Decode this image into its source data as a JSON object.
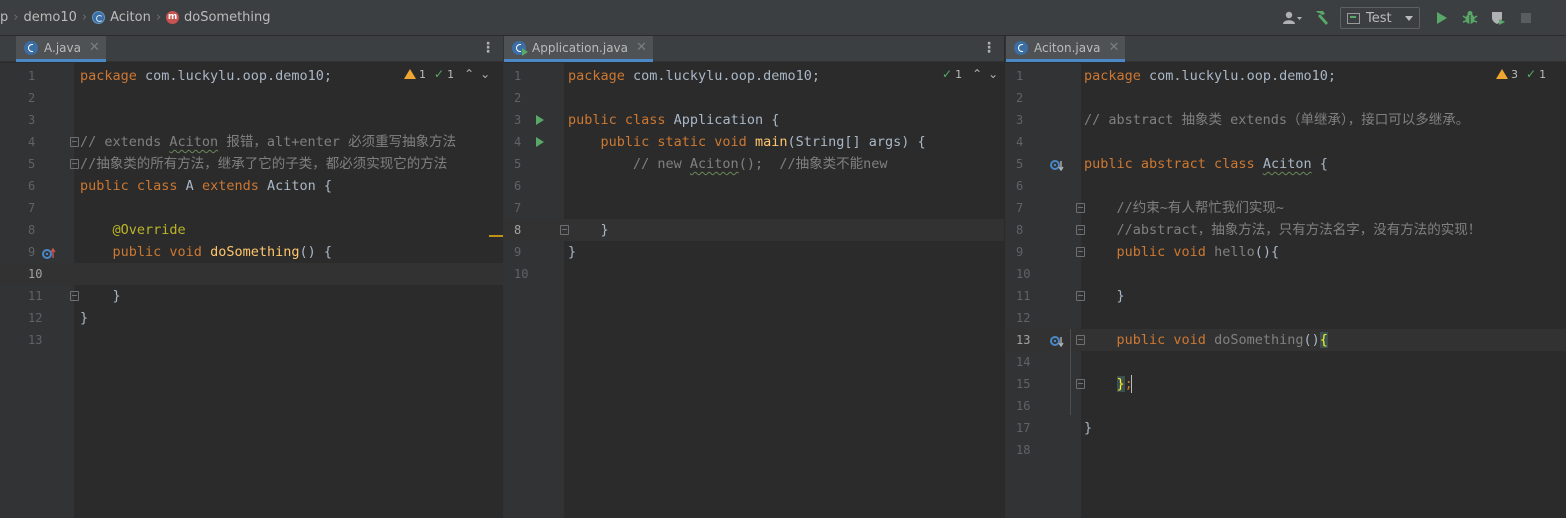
{
  "breadcrumb": {
    "items": [
      {
        "label": "p",
        "icon": ""
      },
      {
        "label": "demo10",
        "icon": ""
      },
      {
        "label": "Aciton",
        "icon": "class-icon"
      },
      {
        "label": "doSomething",
        "icon": "method-icon"
      }
    ]
  },
  "toolbar": {
    "run_config": "Test",
    "icons": [
      "user-icon",
      "hammer-icon",
      "run-icon",
      "debug-icon",
      "coverage-icon",
      "stop-icon"
    ]
  },
  "panes": {
    "a": {
      "tab": "A.java",
      "inspections": {
        "warnings": "1",
        "checks": "1"
      },
      "lines": [
        {
          "n": "1",
          "t": [
            {
              "c": "kw",
              "s": "package "
            },
            {
              "c": "",
              "s": "com.luckylu.oop.demo10;"
            }
          ]
        },
        {
          "n": "2",
          "t": []
        },
        {
          "n": "3",
          "t": []
        },
        {
          "n": "4",
          "t": [
            {
              "c": "cm",
              "s": "// extends "
            },
            {
              "c": "cm wavy",
              "s": "Aciton"
            },
            {
              "c": "cm",
              "s": " 报错，alt+enter 必须重写抽象方法"
            }
          ]
        },
        {
          "n": "5",
          "t": [
            {
              "c": "cm",
              "s": "//抽象类的所有方法，继承了它的子类，都必须实现它的方法"
            }
          ]
        },
        {
          "n": "6",
          "t": [
            {
              "c": "kw",
              "s": "public class "
            },
            {
              "c": "",
              "s": "A "
            },
            {
              "c": "kw",
              "s": "extends "
            },
            {
              "c": "",
              "s": "Aciton {"
            }
          ]
        },
        {
          "n": "7",
          "t": []
        },
        {
          "n": "8",
          "t": [
            {
              "c": "",
              "s": "    "
            },
            {
              "c": "an",
              "s": "@Override"
            }
          ]
        },
        {
          "n": "9",
          "t": [
            {
              "c": "",
              "s": "    "
            },
            {
              "c": "kw",
              "s": "public void "
            },
            {
              "c": "fn",
              "s": "doSomething"
            },
            {
              "c": "",
              "s": "() {"
            }
          ]
        },
        {
          "n": "10",
          "t": []
        },
        {
          "n": "11",
          "t": [
            {
              "c": "",
              "s": "    }"
            }
          ]
        },
        {
          "n": "12",
          "t": [
            {
              "c": "",
              "s": "}"
            }
          ]
        },
        {
          "n": "13",
          "t": []
        }
      ]
    },
    "b": {
      "tab": "Application.java",
      "inspections": {
        "checks": "1"
      },
      "lines": [
        {
          "n": "1",
          "t": [
            {
              "c": "kw",
              "s": "package "
            },
            {
              "c": "",
              "s": "com.luckylu.oop.demo10;"
            }
          ]
        },
        {
          "n": "2",
          "t": []
        },
        {
          "n": "3",
          "t": [
            {
              "c": "kw",
              "s": "public class "
            },
            {
              "c": "",
              "s": "Application {"
            }
          ]
        },
        {
          "n": "4",
          "t": [
            {
              "c": "",
              "s": "    "
            },
            {
              "c": "kw",
              "s": "public static void "
            },
            {
              "c": "fn",
              "s": "main"
            },
            {
              "c": "",
              "s": "(String[] args) {"
            }
          ]
        },
        {
          "n": "5",
          "t": [
            {
              "c": "cm",
              "s": "        // new "
            },
            {
              "c": "cm wavy",
              "s": "Aciton"
            },
            {
              "c": "cm",
              "s": "();  //抽象类不能new"
            }
          ]
        },
        {
          "n": "6",
          "t": []
        },
        {
          "n": "7",
          "t": []
        },
        {
          "n": "8",
          "t": [
            {
              "c": "",
              "s": "    }"
            }
          ]
        },
        {
          "n": "9",
          "t": [
            {
              "c": "",
              "s": "}"
            }
          ]
        },
        {
          "n": "10",
          "t": []
        }
      ]
    },
    "c": {
      "tab": "Aciton.java",
      "inspections": {
        "warnings": "3",
        "checks": "1"
      },
      "lines": [
        {
          "n": "1",
          "t": [
            {
              "c": "kw",
              "s": "package "
            },
            {
              "c": "",
              "s": "com.luckylu.oop.demo10;"
            }
          ]
        },
        {
          "n": "2",
          "t": []
        },
        {
          "n": "3",
          "t": [
            {
              "c": "cm",
              "s": "// abstract 抽象类 extends（单继承），接口可以多继承。"
            }
          ]
        },
        {
          "n": "4",
          "t": []
        },
        {
          "n": "5",
          "t": [
            {
              "c": "kw",
              "s": "public abstract class "
            },
            {
              "c": "wavy",
              "s": "Aciton"
            },
            {
              "c": "",
              "s": " {"
            }
          ]
        },
        {
          "n": "6",
          "t": []
        },
        {
          "n": "7",
          "t": [
            {
              "c": "cm",
              "s": "    //约束~有人帮忙我们实现~"
            }
          ]
        },
        {
          "n": "8",
          "t": [
            {
              "c": "cm",
              "s": "    //abstract，抽象方法，只有方法名字，没有方法的实现！"
            }
          ]
        },
        {
          "n": "9",
          "t": [
            {
              "c": "",
              "s": "    "
            },
            {
              "c": "kw",
              "s": "public void "
            },
            {
              "c": "unused",
              "s": "hello"
            },
            {
              "c": "",
              "s": "(){"
            }
          ]
        },
        {
          "n": "10",
          "t": []
        },
        {
          "n": "11",
          "t": [
            {
              "c": "",
              "s": "    }"
            }
          ]
        },
        {
          "n": "12",
          "t": []
        },
        {
          "n": "13",
          "t": [
            {
              "c": "",
              "s": "    "
            },
            {
              "c": "kw",
              "s": "public void "
            },
            {
              "c": "unused",
              "s": "doSomething"
            },
            {
              "c": "",
              "s": "()"
            },
            {
              "c": "bracehl",
              "s": "{"
            }
          ]
        },
        {
          "n": "14",
          "t": []
        },
        {
          "n": "15",
          "t": [
            {
              "c": "",
              "s": "    "
            },
            {
              "c": "bracehl",
              "s": "}"
            },
            {
              "c": "kw",
              "s": ";"
            }
          ]
        },
        {
          "n": "16",
          "t": []
        },
        {
          "n": "17",
          "t": [
            {
              "c": "",
              "s": "}"
            }
          ]
        },
        {
          "n": "18",
          "t": []
        }
      ]
    }
  },
  "colors": {
    "keyword": "#cc7832",
    "comment": "#808080",
    "annotation": "#bbb529",
    "method": "#ffc66d",
    "text": "#a9b7c6",
    "run": "#59a869",
    "tab_underline": "#4a88c7"
  }
}
